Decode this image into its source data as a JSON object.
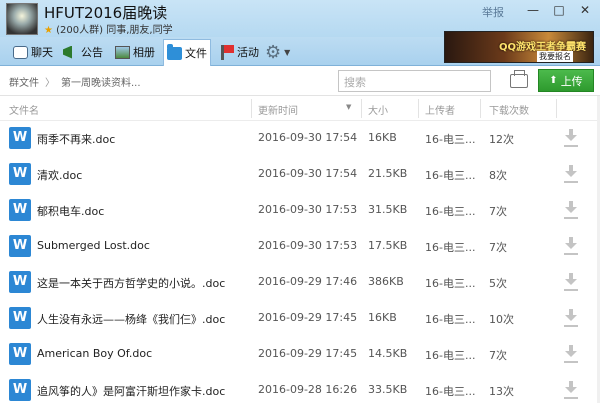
{
  "window": {
    "group_name": "HFUT2016届晚读",
    "group_sub": "(200人群) 同事,朋友,同学",
    "star": "★",
    "report_label": "举报",
    "minimize": "—",
    "maximize": "□",
    "close": "✕"
  },
  "toolbar": {
    "chat": "聊天",
    "notice": "公告",
    "album": "相册",
    "files": "文件",
    "activity": "活动",
    "gear": "⚙",
    "caret": "▼"
  },
  "ad": {
    "text": "QQ游戏王者争霸赛",
    "button": "我要报名"
  },
  "breadcrumb": {
    "root": "群文件",
    "sep": "〉",
    "current": "第一周晚读资料..."
  },
  "search": {
    "placeholder": "搜索"
  },
  "upload": {
    "arrow": "⬆",
    "label": "上传"
  },
  "table": {
    "headers": {
      "name": "文件名",
      "time": "更新时间",
      "size": "大小",
      "uploader": "上传者",
      "downloads": "下载次数",
      "sort_caret": "▼"
    },
    "icon_letter": "W",
    "rows": [
      {
        "name": "雨季不再来.doc",
        "time": "2016-09-30 17:54",
        "size": "16KB",
        "uploader": "16-电三...",
        "downloads": "12次"
      },
      {
        "name": "清欢.doc",
        "time": "2016-09-30 17:54",
        "size": "21.5KB",
        "uploader": "16-电三...",
        "downloads": "8次"
      },
      {
        "name": "郁积电车.doc",
        "time": "2016-09-30 17:53",
        "size": "31.5KB",
        "uploader": "16-电三...",
        "downloads": "7次"
      },
      {
        "name": "Submerged Lost.doc",
        "time": "2016-09-30 17:53",
        "size": "17.5KB",
        "uploader": "16-电三...",
        "downloads": "7次"
      },
      {
        "name": "这是一本关于西方哲学史的小说。.doc",
        "time": "2016-09-29 17:46",
        "size": "386KB",
        "uploader": "16-电三...",
        "downloads": "5次"
      },
      {
        "name": "人生没有永远——杨绛《我们仨》.doc",
        "time": "2016-09-29 17:45",
        "size": "16KB",
        "uploader": "16-电三...",
        "downloads": "10次"
      },
      {
        "name": "American Boy Of.doc",
        "time": "2016-09-29 17:45",
        "size": "14.5KB",
        "uploader": "16-电三...",
        "downloads": "7次"
      },
      {
        "name": "追风筝的人》是阿富汗斯坦作家卡.doc",
        "time": "2016-09-28 16:26",
        "size": "33.5KB",
        "uploader": "16-电三...",
        "downloads": "13次"
      }
    ]
  }
}
